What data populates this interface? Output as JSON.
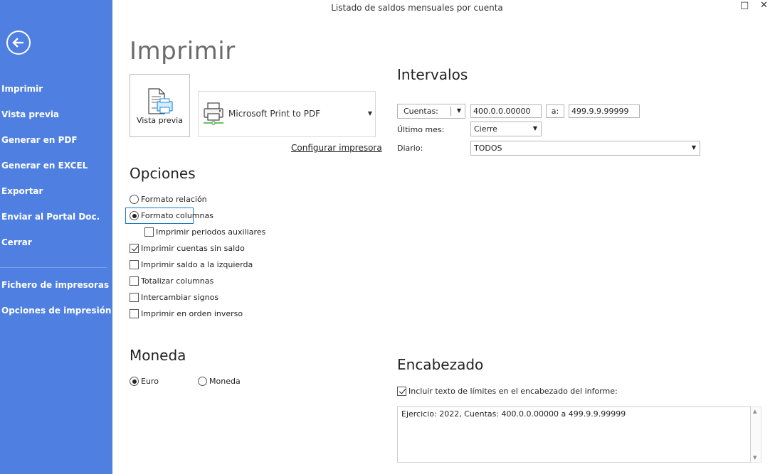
{
  "window": {
    "title": "Listado de saldos mensuales por cuenta",
    "maximize_icon": "□",
    "close_icon": "✕"
  },
  "sidebar": {
    "back_icon": "arrow-left-circle",
    "items": [
      {
        "label": "Imprimir"
      },
      {
        "label": "Vista previa"
      },
      {
        "label": "Generar en PDF"
      },
      {
        "label": "Generar en EXCEL"
      },
      {
        "label": "Exportar"
      },
      {
        "label": "Enviar al Portal Doc."
      },
      {
        "label": "Cerrar"
      },
      {
        "label": "Fichero de impresoras"
      },
      {
        "label": "Opciones de impresión"
      }
    ],
    "color": "#4f7fe0"
  },
  "page_title": "Imprimir",
  "print": {
    "preview_label": "Vista previa",
    "printer_name": "Microsoft Print to PDF",
    "config_link": "Configurar impresora"
  },
  "options": {
    "title": "Opciones",
    "items": [
      {
        "label": "Formato relación",
        "type": "radio",
        "checked": false
      },
      {
        "label": "Formato columnas",
        "type": "radio",
        "checked": true
      },
      {
        "label": "Imprimir periodos auxiliares",
        "type": "check",
        "checked": false
      },
      {
        "label": "Imprimir cuentas sin saldo",
        "type": "check",
        "checked": true
      },
      {
        "label": "Imprimir saldo a la izquierda",
        "type": "check",
        "checked": false
      },
      {
        "label": "Totalizar columnas",
        "type": "check",
        "checked": false
      },
      {
        "label": "Intercambiar signos",
        "type": "check",
        "checked": false
      },
      {
        "label": "Imprimir en orden inverso",
        "type": "check",
        "checked": false
      }
    ]
  },
  "currency": {
    "title": "Moneda",
    "euro": "Euro",
    "moneda": "Moneda",
    "selected": "Euro"
  },
  "intervals": {
    "title": "Intervalos",
    "range_type": "Cuentas:",
    "from": "400.0.0.00000",
    "to_label": "a:",
    "to": "499.9.9.99999",
    "last_month_label": "Último mes:",
    "last_month": "Cierre",
    "journal_label": "Diario:",
    "journal": "TODOS"
  },
  "header": {
    "title": "Encabezado",
    "include_label": "Incluir texto de límites en el encabezado del informe:",
    "include_checked": true,
    "text": "Ejercicio: 2022, Cuentas: 400.0.0.00000 a 499.9.9.99999"
  }
}
